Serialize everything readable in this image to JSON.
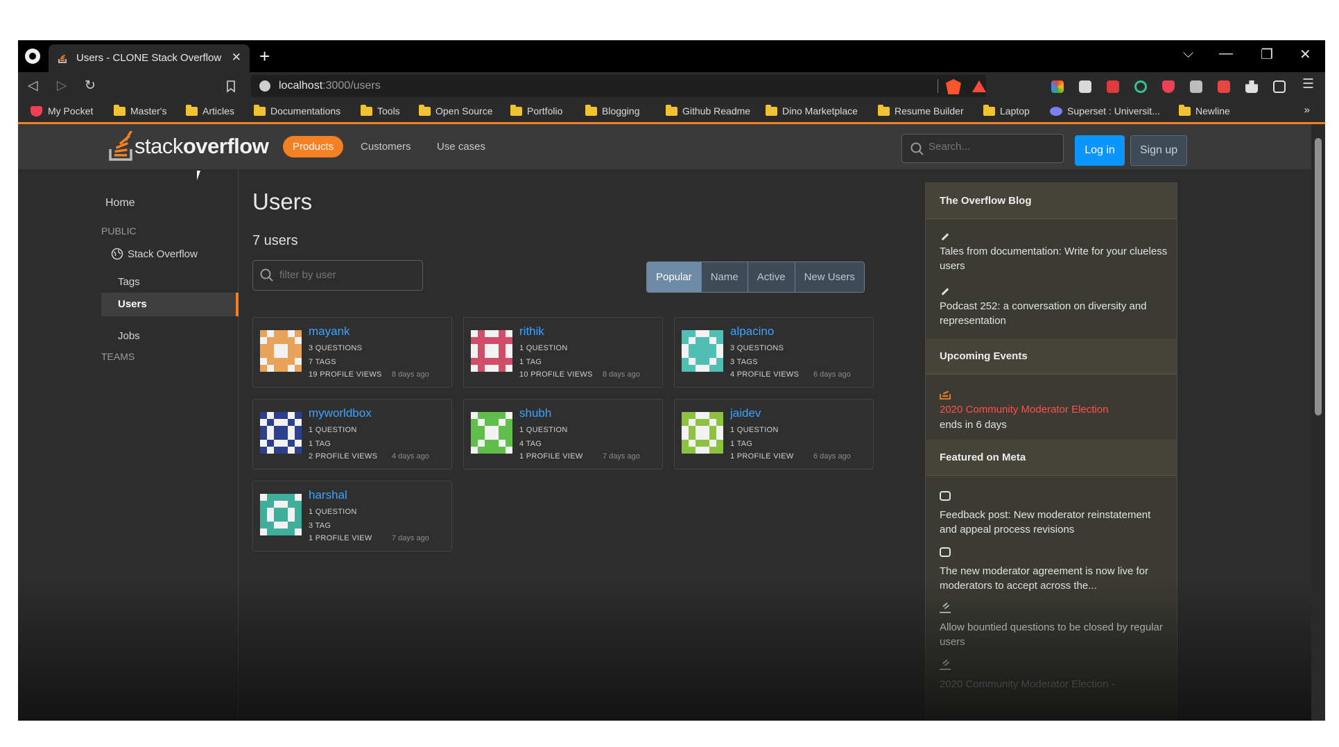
{
  "browser": {
    "tab_title": "Users - CLONE Stack Overflow",
    "tab_close": "✕",
    "new_tab": "+",
    "url_host": "localhost",
    "url_path": ":3000/users",
    "window_controls": {
      "dropdown": "⌵",
      "minimize": "—",
      "maximize": "❐",
      "close": "✕"
    },
    "bookmarks": [
      "My Pocket",
      "Master's",
      "Articles",
      "Documentations",
      "Tools",
      "Open Source",
      "Portfolio",
      "Blogging",
      "Github Readme",
      "Dino Marketplace",
      "Resume Builder",
      "Laptop",
      "Superset : Universit...",
      "Newline"
    ],
    "bookmarks_more": "»"
  },
  "topbar": {
    "logo_light": "stack",
    "logo_bold": "overflow",
    "products": "Products",
    "customers": "Customers",
    "use_cases": "Use cases",
    "search_placeholder": "Search...",
    "login": "Log in",
    "signup": "Sign up"
  },
  "sidebar": {
    "home": "Home",
    "public": "PUBLIC",
    "stack_overflow": "Stack Overflow",
    "tags": "Tags",
    "users": "Users",
    "jobs": "Jobs",
    "teams": "TEAMS"
  },
  "main": {
    "title": "Users",
    "count": "7 users",
    "filter_placeholder": "filter by user",
    "sorts": [
      "Popular",
      "Name",
      "Active",
      "New Users"
    ],
    "users": [
      {
        "name": "mayank",
        "questions": "3 QUESTIONS",
        "tags": "7 TAGS",
        "views": "19 PROFILE VIEWS",
        "seen": "8 days ago",
        "color": "#e8a25a"
      },
      {
        "name": "rithik",
        "questions": "1 QUESTION",
        "tags": "1 TAG",
        "views": "10 PROFILE VIEWS",
        "seen": "8 days ago",
        "color": "#d04e6a"
      },
      {
        "name": "alpacino",
        "questions": "3 QUESTIONS",
        "tags": "3 TAGS",
        "views": "4 PROFILE VIEWS",
        "seen": "6 days ago",
        "color": "#4fbfb3"
      },
      {
        "name": "myworldbox",
        "questions": "1 QUESTION",
        "tags": "1 TAG",
        "views": "2 PROFILE VIEWS",
        "seen": "4 days ago",
        "color": "#2d3f8f"
      },
      {
        "name": "shubh",
        "questions": "1 QUESTION",
        "tags": "4 TAG",
        "views": "1 PROFILE VIEW",
        "seen": "7 days ago",
        "color": "#5fbf4a"
      },
      {
        "name": "jaidev",
        "questions": "1 QUESTION",
        "tags": "1 TAG",
        "views": "1 PROFILE VIEW",
        "seen": "6 days ago",
        "color": "#8cc23f"
      },
      {
        "name": "harshal",
        "questions": "1 QUESTION",
        "tags": "3 TAG",
        "views": "1 PROFILE VIEW",
        "seen": "7 days ago",
        "color": "#3fae9a"
      }
    ]
  },
  "rightcol": {
    "blog_header": "The Overflow Blog",
    "blog_1": "Tales from documentation: Write for your clueless users",
    "blog_2": "Podcast 252: a conversation on diversity and representation",
    "events_header": "Upcoming Events",
    "event_1": "2020 Community Moderator Election",
    "event_1_sub": "ends in 6 days",
    "meta_header": "Featured on Meta",
    "meta_1": "Feedback post: New moderator reinstatement and appeal process revisions",
    "meta_2": "The new moderator agreement is now live for moderators to accept across the...",
    "meta_3": "Allow bountied questions to be closed by regular users",
    "meta_4": "2020 Community Moderator Election -"
  },
  "colors": {
    "accent": "#f48024",
    "link": "#3ca4ff",
    "login": "#0a95ff",
    "page_bg": "#2d2d2d"
  }
}
